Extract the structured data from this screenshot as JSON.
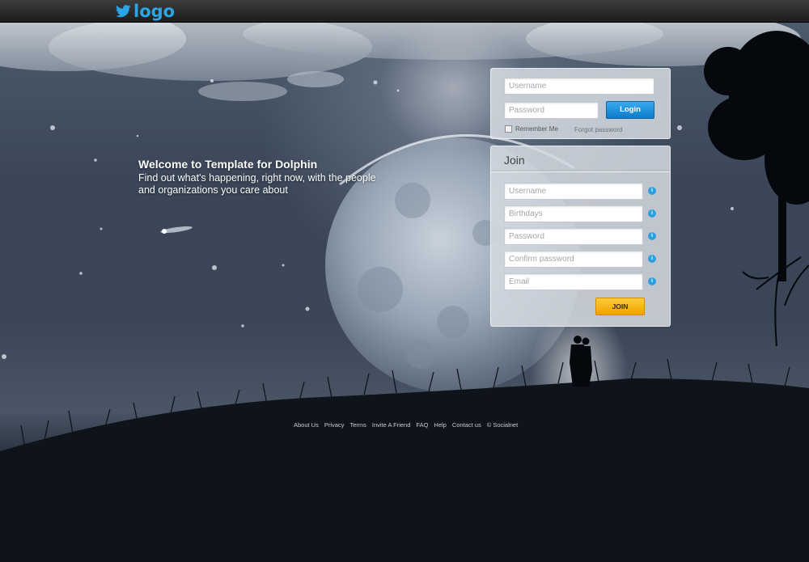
{
  "header": {
    "logo_text": "logo",
    "logo_icon": "twitter-bird-icon",
    "accent_color": "#2aa6e6"
  },
  "welcome": {
    "title": "Welcome to Template for Dolphin",
    "line1": "Find out what's happening, right now, with the people",
    "line2": "and organizations you care about"
  },
  "login": {
    "username_placeholder": "Username",
    "password_placeholder": "Password",
    "login_label": "Login",
    "remember_label": "Remember Me",
    "forgot_label": "Forgot password",
    "button_color": "#0b7bc9"
  },
  "join": {
    "title": "Join",
    "fields": [
      {
        "placeholder": "Username"
      },
      {
        "placeholder": "Birthdays"
      },
      {
        "placeholder": "Password"
      },
      {
        "placeholder": "Confirm password"
      },
      {
        "placeholder": "Email"
      }
    ],
    "join_label": "JOIN",
    "button_color": "#f0a100",
    "info_icon": "info-icon"
  },
  "footer": {
    "links": [
      "About Us",
      "Privacy",
      "Terms",
      "Invite A Friend",
      "FAQ",
      "Help",
      "Contact us"
    ],
    "copyright": "© Socialnet"
  }
}
